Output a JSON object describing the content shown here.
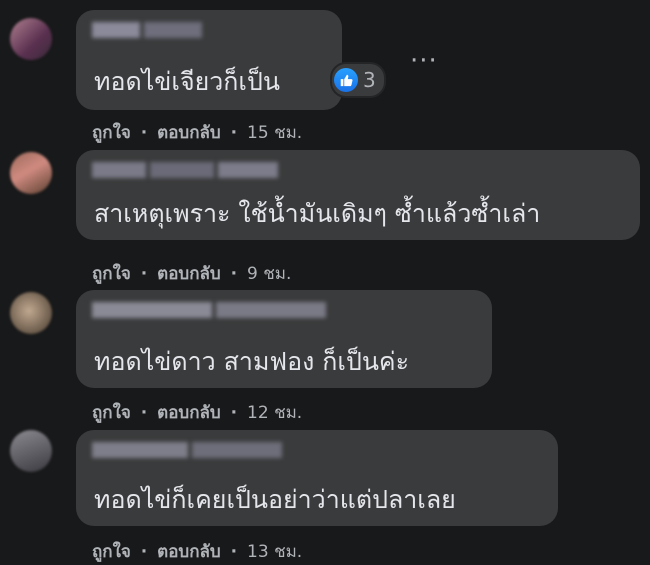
{
  "comments": [
    {
      "text": "ทอดไข่เจียวก็เป็น",
      "like_label": "ถูกใจ",
      "reply_label": "ตอบกลับ",
      "time": "15 ชม.",
      "reaction_icon": "thumbs-up-icon",
      "reaction_count": "3"
    },
    {
      "text": "สาเหตุเพราะ ใช้น้ำมันเดิมๆ ซ้ำแล้วซ้ำเล่า",
      "like_label": "ถูกใจ",
      "reply_label": "ตอบกลับ",
      "time": "9 ชม."
    },
    {
      "text": "ทอดไข่ดาว สามฟอง ก็เป็นค่ะ",
      "like_label": "ถูกใจ",
      "reply_label": "ตอบกลับ",
      "time": "12 ชม."
    },
    {
      "text": "ทอดไข่ก็เคยเป็นอย่าว่าแต่ปลาเลย",
      "like_label": "ถูกใจ",
      "reply_label": "ตอบกลับ",
      "time": "13 ชม."
    }
  ],
  "separator": "·",
  "more_icon": "more-options-icon",
  "colors": {
    "background": "#18191a",
    "bubble": "#3a3b3c",
    "text": "#e4e6eb",
    "secondary_text": "#b0b3b8",
    "like_blue": "#1877f2"
  }
}
